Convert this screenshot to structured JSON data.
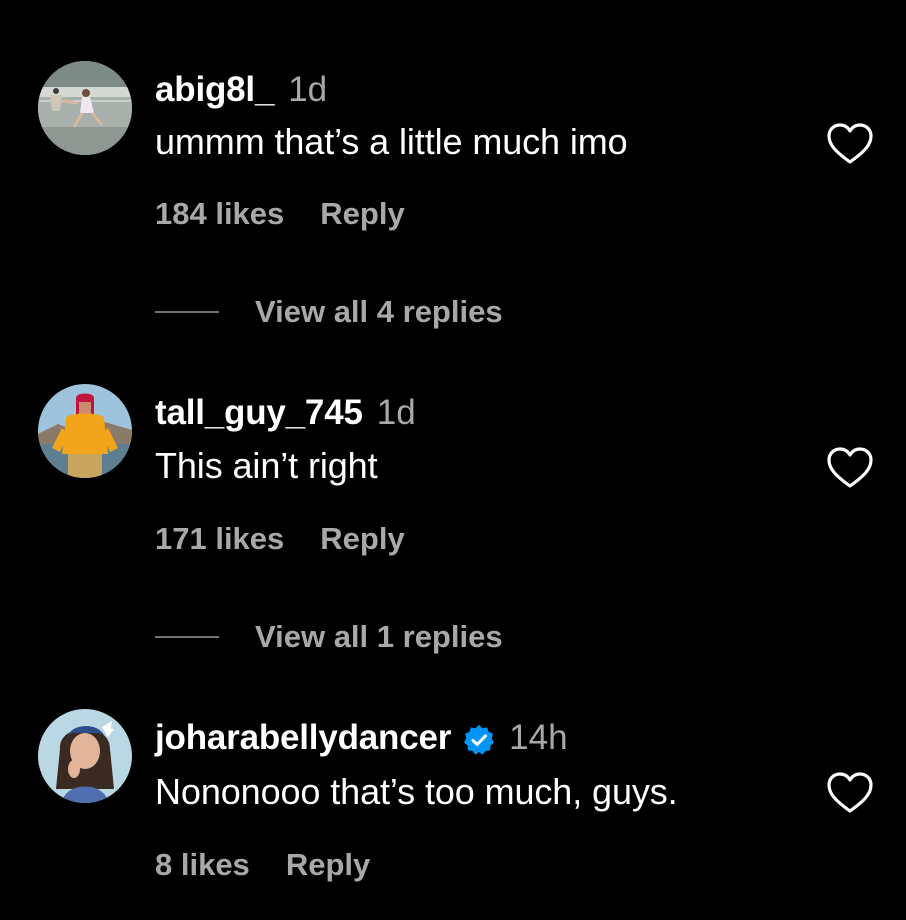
{
  "colors": {
    "background": "#000000",
    "primary_text": "#ffffff",
    "secondary_text": "#a8a8a8",
    "verified_badge": "#0095f6"
  },
  "comments": [
    {
      "username": "abig8l_",
      "time": "1d",
      "text": "ummm that’s a little much imo",
      "likes": "184 likes",
      "reply_label": "Reply",
      "view_replies": "View all 4 replies",
      "verified": false,
      "avatar_icon": "tennis-player-avatar"
    },
    {
      "username": "tall_guy_745",
      "time": "1d",
      "text": "This ain’t right",
      "likes": "171 likes",
      "reply_label": "Reply",
      "view_replies": "View all 1 replies",
      "verified": false,
      "avatar_icon": "person-in-yellow-hoodie-avatar"
    },
    {
      "username": "joharabellydancer",
      "time": "14h",
      "text": "Nononooo that’s too much, guys.",
      "likes": "8 likes",
      "reply_label": "Reply",
      "verified": true,
      "avatar_icon": "woman-with-bow-avatar"
    }
  ]
}
